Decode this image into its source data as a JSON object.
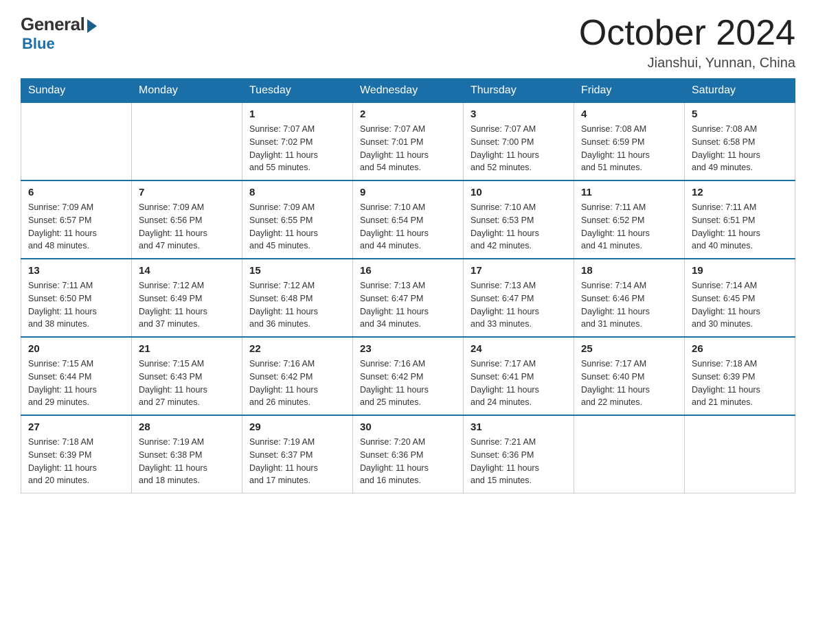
{
  "logo": {
    "general": "General",
    "blue": "Blue"
  },
  "title": "October 2024",
  "location": "Jianshui, Yunnan, China",
  "days_of_week": [
    "Sunday",
    "Monday",
    "Tuesday",
    "Wednesday",
    "Thursday",
    "Friday",
    "Saturday"
  ],
  "weeks": [
    [
      {
        "day": "",
        "info": ""
      },
      {
        "day": "",
        "info": ""
      },
      {
        "day": "1",
        "info": "Sunrise: 7:07 AM\nSunset: 7:02 PM\nDaylight: 11 hours\nand 55 minutes."
      },
      {
        "day": "2",
        "info": "Sunrise: 7:07 AM\nSunset: 7:01 PM\nDaylight: 11 hours\nand 54 minutes."
      },
      {
        "day": "3",
        "info": "Sunrise: 7:07 AM\nSunset: 7:00 PM\nDaylight: 11 hours\nand 52 minutes."
      },
      {
        "day": "4",
        "info": "Sunrise: 7:08 AM\nSunset: 6:59 PM\nDaylight: 11 hours\nand 51 minutes."
      },
      {
        "day": "5",
        "info": "Sunrise: 7:08 AM\nSunset: 6:58 PM\nDaylight: 11 hours\nand 49 minutes."
      }
    ],
    [
      {
        "day": "6",
        "info": "Sunrise: 7:09 AM\nSunset: 6:57 PM\nDaylight: 11 hours\nand 48 minutes."
      },
      {
        "day": "7",
        "info": "Sunrise: 7:09 AM\nSunset: 6:56 PM\nDaylight: 11 hours\nand 47 minutes."
      },
      {
        "day": "8",
        "info": "Sunrise: 7:09 AM\nSunset: 6:55 PM\nDaylight: 11 hours\nand 45 minutes."
      },
      {
        "day": "9",
        "info": "Sunrise: 7:10 AM\nSunset: 6:54 PM\nDaylight: 11 hours\nand 44 minutes."
      },
      {
        "day": "10",
        "info": "Sunrise: 7:10 AM\nSunset: 6:53 PM\nDaylight: 11 hours\nand 42 minutes."
      },
      {
        "day": "11",
        "info": "Sunrise: 7:11 AM\nSunset: 6:52 PM\nDaylight: 11 hours\nand 41 minutes."
      },
      {
        "day": "12",
        "info": "Sunrise: 7:11 AM\nSunset: 6:51 PM\nDaylight: 11 hours\nand 40 minutes."
      }
    ],
    [
      {
        "day": "13",
        "info": "Sunrise: 7:11 AM\nSunset: 6:50 PM\nDaylight: 11 hours\nand 38 minutes."
      },
      {
        "day": "14",
        "info": "Sunrise: 7:12 AM\nSunset: 6:49 PM\nDaylight: 11 hours\nand 37 minutes."
      },
      {
        "day": "15",
        "info": "Sunrise: 7:12 AM\nSunset: 6:48 PM\nDaylight: 11 hours\nand 36 minutes."
      },
      {
        "day": "16",
        "info": "Sunrise: 7:13 AM\nSunset: 6:47 PM\nDaylight: 11 hours\nand 34 minutes."
      },
      {
        "day": "17",
        "info": "Sunrise: 7:13 AM\nSunset: 6:47 PM\nDaylight: 11 hours\nand 33 minutes."
      },
      {
        "day": "18",
        "info": "Sunrise: 7:14 AM\nSunset: 6:46 PM\nDaylight: 11 hours\nand 31 minutes."
      },
      {
        "day": "19",
        "info": "Sunrise: 7:14 AM\nSunset: 6:45 PM\nDaylight: 11 hours\nand 30 minutes."
      }
    ],
    [
      {
        "day": "20",
        "info": "Sunrise: 7:15 AM\nSunset: 6:44 PM\nDaylight: 11 hours\nand 29 minutes."
      },
      {
        "day": "21",
        "info": "Sunrise: 7:15 AM\nSunset: 6:43 PM\nDaylight: 11 hours\nand 27 minutes."
      },
      {
        "day": "22",
        "info": "Sunrise: 7:16 AM\nSunset: 6:42 PM\nDaylight: 11 hours\nand 26 minutes."
      },
      {
        "day": "23",
        "info": "Sunrise: 7:16 AM\nSunset: 6:42 PM\nDaylight: 11 hours\nand 25 minutes."
      },
      {
        "day": "24",
        "info": "Sunrise: 7:17 AM\nSunset: 6:41 PM\nDaylight: 11 hours\nand 24 minutes."
      },
      {
        "day": "25",
        "info": "Sunrise: 7:17 AM\nSunset: 6:40 PM\nDaylight: 11 hours\nand 22 minutes."
      },
      {
        "day": "26",
        "info": "Sunrise: 7:18 AM\nSunset: 6:39 PM\nDaylight: 11 hours\nand 21 minutes."
      }
    ],
    [
      {
        "day": "27",
        "info": "Sunrise: 7:18 AM\nSunset: 6:39 PM\nDaylight: 11 hours\nand 20 minutes."
      },
      {
        "day": "28",
        "info": "Sunrise: 7:19 AM\nSunset: 6:38 PM\nDaylight: 11 hours\nand 18 minutes."
      },
      {
        "day": "29",
        "info": "Sunrise: 7:19 AM\nSunset: 6:37 PM\nDaylight: 11 hours\nand 17 minutes."
      },
      {
        "day": "30",
        "info": "Sunrise: 7:20 AM\nSunset: 6:36 PM\nDaylight: 11 hours\nand 16 minutes."
      },
      {
        "day": "31",
        "info": "Sunrise: 7:21 AM\nSunset: 6:36 PM\nDaylight: 11 hours\nand 15 minutes."
      },
      {
        "day": "",
        "info": ""
      },
      {
        "day": "",
        "info": ""
      }
    ]
  ]
}
